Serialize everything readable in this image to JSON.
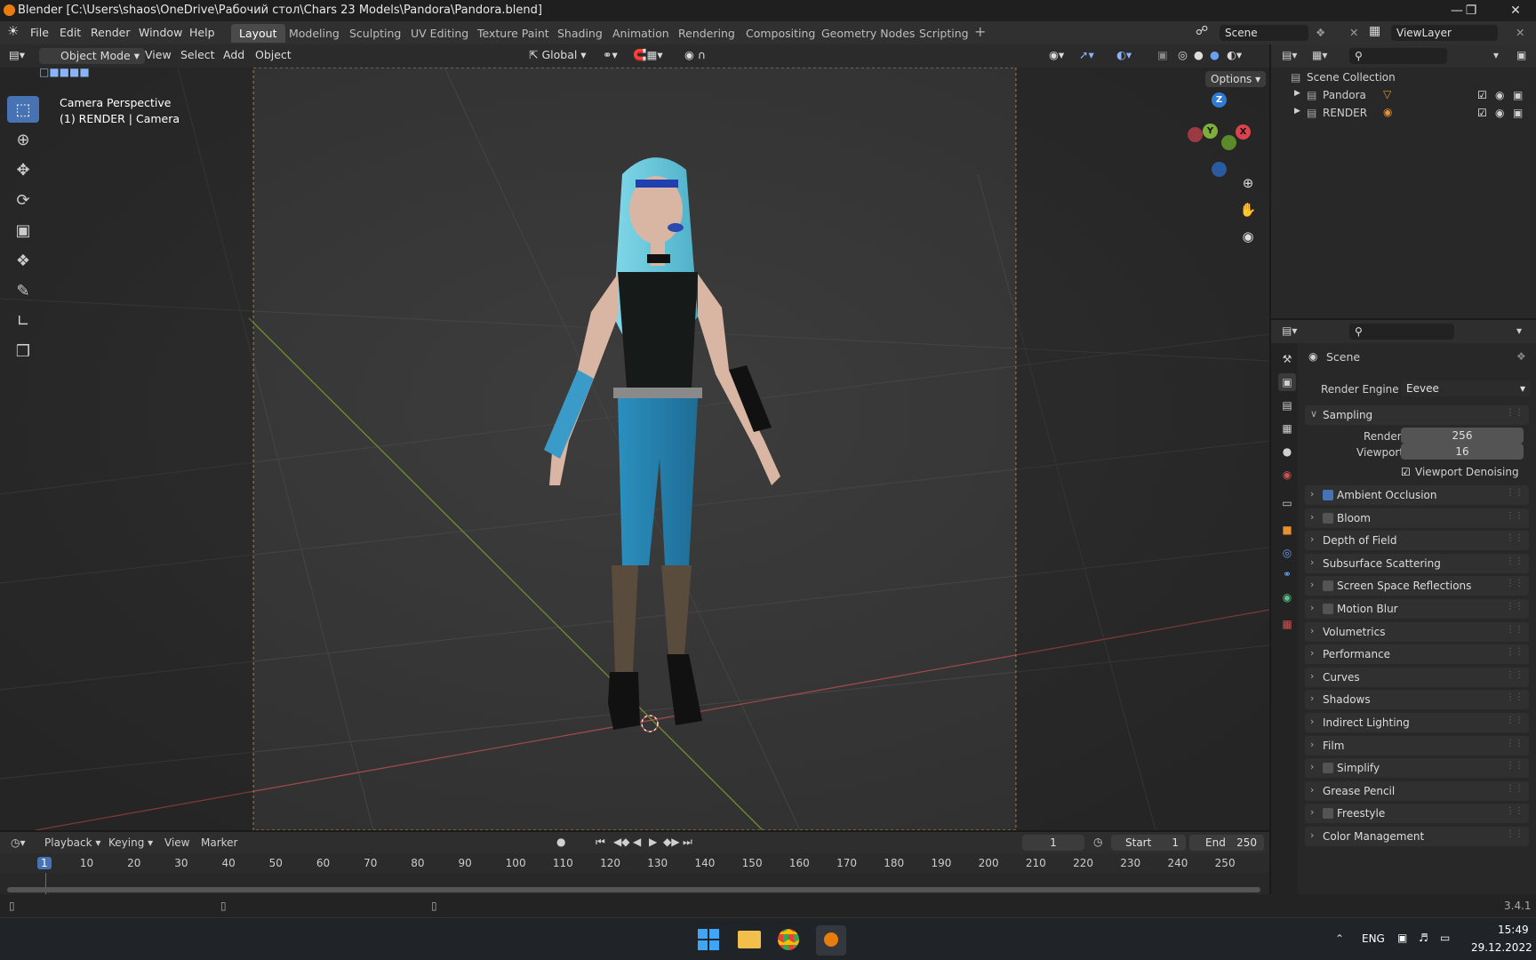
{
  "titlebar": {
    "title": "Blender [C:\\Users\\shaos\\OneDrive\\Рабочий стол\\Chars 23 Models\\Pandora\\Pandora.blend]"
  },
  "menu": {
    "items": [
      "File",
      "Edit",
      "Render",
      "Window",
      "Help"
    ]
  },
  "workspaces": [
    "Layout",
    "Modeling",
    "Sculpting",
    "UV Editing",
    "Texture Paint",
    "Shading",
    "Animation",
    "Rendering",
    "Compositing",
    "Geometry Nodes",
    "Scripting"
  ],
  "scene": {
    "scene_name": "Scene",
    "view_layer": "ViewLayer"
  },
  "viewport_header": {
    "mode": "Object Mode",
    "menus": [
      "View",
      "Select",
      "Add",
      "Object"
    ],
    "orientation": "Global",
    "options": "Options"
  },
  "viewport": {
    "camera_label": "Camera Perspective",
    "object_label": "(1) RENDER | Camera"
  },
  "gizmo": {
    "z": "Z",
    "y": "Y",
    "x": "X"
  },
  "outliner": {
    "root": "Scene Collection",
    "items": [
      "Pandora",
      "RENDER"
    ]
  },
  "properties": {
    "context": "Scene",
    "render_engine_label": "Render Engine",
    "render_engine": "Eevee",
    "sampling": "Sampling",
    "render_label": "Render",
    "render_value": "256",
    "viewport_label": "Viewport",
    "viewport_value": "16",
    "denoising": "Viewport Denoising",
    "panels": [
      "Ambient Occlusion",
      "Bloom",
      "Depth of Field",
      "Subsurface Scattering",
      "Screen Space Reflections",
      "Motion Blur",
      "Volumetrics",
      "Performance",
      "Curves",
      "Shadows",
      "Indirect Lighting",
      "Film",
      "Simplify",
      "Grease Pencil",
      "Freestyle",
      "Color Management"
    ]
  },
  "timeline": {
    "menus": [
      "Playback",
      "Keying",
      "View",
      "Marker"
    ],
    "current_frame": "1",
    "start_label": "Start",
    "start": "1",
    "end_label": "End",
    "end": "250",
    "ticks": [
      "1",
      "10",
      "20",
      "30",
      "40",
      "50",
      "60",
      "70",
      "80",
      "90",
      "100",
      "110",
      "120",
      "130",
      "140",
      "150",
      "160",
      "170",
      "180",
      "190",
      "200",
      "210",
      "220",
      "230",
      "240",
      "250"
    ]
  },
  "status": {
    "version": "3.4.1"
  },
  "taskbar": {
    "lang": "ENG",
    "time": "15:49",
    "date": "29.12.2022"
  }
}
